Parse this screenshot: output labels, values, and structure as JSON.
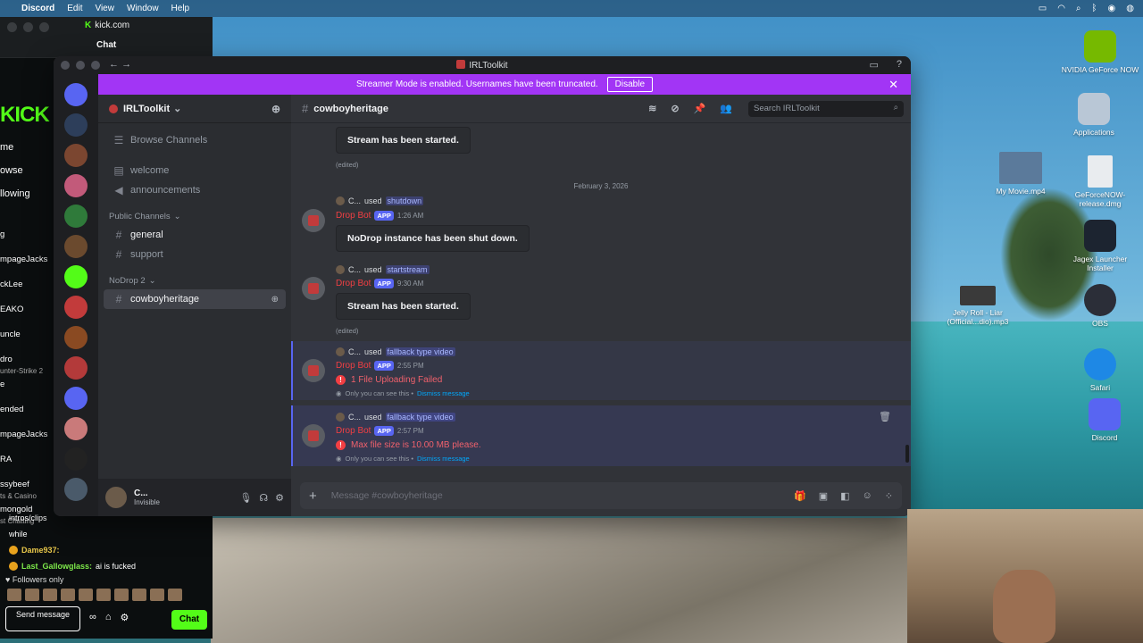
{
  "menubar": {
    "app": "Discord",
    "items": [
      "Edit",
      "View",
      "Window",
      "Help"
    ]
  },
  "kick": {
    "url": "kick.com",
    "chat_title": "Chat",
    "logo": "KICK",
    "nav": [
      "me",
      "owse",
      "llowing"
    ],
    "channels": [
      "g",
      "mpageJacks",
      "ckLee",
      "EAKO",
      "uncle",
      "dro",
      "e",
      "ended",
      "mpageJacks",
      "RA",
      "ssybeef",
      "mongold"
    ],
    "channel_subs": [
      "unter-Strike 2",
      "ts & Casino",
      "st Chatting"
    ],
    "chat_lines": [
      {
        "user": "",
        "text": "intros/clips"
      },
      {
        "user": "",
        "text": "while"
      },
      {
        "user": "Dame937:",
        "text": ""
      },
      {
        "user": "Last_Gallowglass:",
        "text": "ai is fucked"
      }
    ],
    "followers_only": "Followers only",
    "send_placeholder": "Send message",
    "chat_button": "Chat"
  },
  "discord": {
    "window_title": "IRLToolkit",
    "banner": {
      "text": "Streamer Mode is enabled. Usernames have been truncated.",
      "button": "Disable"
    },
    "server_name": "IRLToolkit",
    "browse": "Browse Channels",
    "channels_top": [
      "welcome",
      "announcements"
    ],
    "cat_public": "Public Channels",
    "channels_public": [
      "general",
      "support"
    ],
    "cat_nodrop": "NoDrop 2",
    "active_channel": "cowboyheritage",
    "user": {
      "name": "C...",
      "status": "Invisible"
    },
    "header_channel": "cowboyheritage",
    "search_placeholder": "Search IRLToolkit",
    "date_divider": "February 3, 2026",
    "messages": [
      {
        "embed": "Stream has been started.",
        "edited": "(edited)"
      },
      {
        "user": "C...",
        "used": "used",
        "cmd": "shutdown",
        "bot": "Drop Bot",
        "app": "APP",
        "time": "1:26 AM",
        "embed": "NoDrop instance has been shut down."
      },
      {
        "user": "C...",
        "used": "used",
        "cmd": "startstream",
        "bot": "Drop Bot",
        "app": "APP",
        "time": "9:30 AM",
        "embed": "Stream has been started.",
        "edited": "(edited)"
      },
      {
        "user": "C...",
        "used": "used",
        "cmd": "fallback type video",
        "bot": "Drop Bot",
        "app": "APP",
        "time": "2:55 PM",
        "error": "1 File Uploading Failed",
        "eph": "Only you can see this •",
        "dismiss": "Dismiss message"
      },
      {
        "user": "C...",
        "used": "used",
        "cmd": "fallback type video",
        "bot": "Drop Bot",
        "app": "APP",
        "time": "2:57 PM",
        "error": "Max file size is 10.00 MB please.",
        "eph": "Only you can see this •",
        "dismiss": "Dismiss message"
      }
    ],
    "composer_placeholder": "Message #cowboyheritage"
  },
  "desktop_icons": [
    {
      "label": "NVIDIA GeForce NOW",
      "color": "#76b900"
    },
    {
      "label": "Applications",
      "color": "#b9c7d6"
    },
    {
      "label": "My Movie.mp4",
      "color": "#5b7a9b"
    },
    {
      "label": "GeForceNOW-release.dmg",
      "color": "#e9ecef"
    },
    {
      "label": "Jagex Launcher Installer",
      "color": "#1c2430"
    },
    {
      "label": "Jelly Roll - Liar (Official...dio).mp3",
      "color": "#3a3a3a"
    },
    {
      "label": "OBS",
      "color": "#2b2e38"
    },
    {
      "label": "Safari",
      "color": "#1e88e5"
    },
    {
      "label": "Discord",
      "color": "#5865f2"
    }
  ]
}
